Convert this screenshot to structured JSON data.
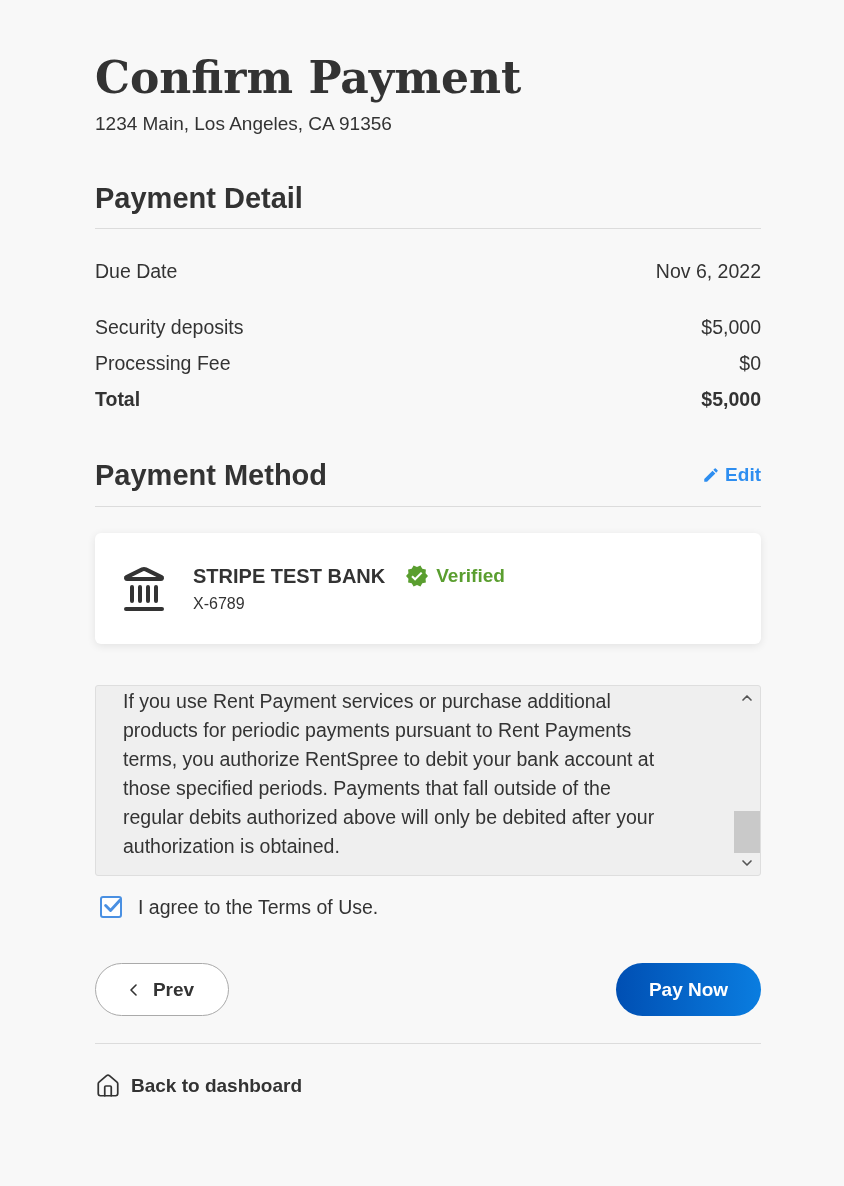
{
  "header": {
    "title": "Confirm Payment",
    "address": "1234 Main, Los Angeles, CA 91356"
  },
  "payment_detail": {
    "heading": "Payment Detail",
    "rows": [
      {
        "kind": "date",
        "label": "Due Date",
        "value": "Nov 6, 2022"
      },
      {
        "kind": "line",
        "label": "Security deposits",
        "value": "$5,000"
      },
      {
        "kind": "line",
        "label": "Processing Fee",
        "value": "$0"
      },
      {
        "kind": "total",
        "label": "Total",
        "value": "$5,000"
      }
    ]
  },
  "payment_method": {
    "heading": "Payment Method",
    "edit": "Edit",
    "account": {
      "bank": "STRIPE TEST BANK",
      "verified": true,
      "status": "Verified",
      "number": "X-6789"
    }
  },
  "terms": {
    "text": "If you use Rent Payment services or purchase additional products for periodic payments pursuant to Rent Payments terms, you authorize RentSpree to debit your bank account at those specified periods. Payments that fall outside of the regular debits authorized above will only be debited after your authorization is obtained.",
    "agree": {
      "label": "I agree to the Terms of Use.",
      "checked": true
    }
  },
  "actions": {
    "prev": "Prev",
    "pay": "Pay Now"
  },
  "footer": {
    "back": "Back to dashboard"
  }
}
